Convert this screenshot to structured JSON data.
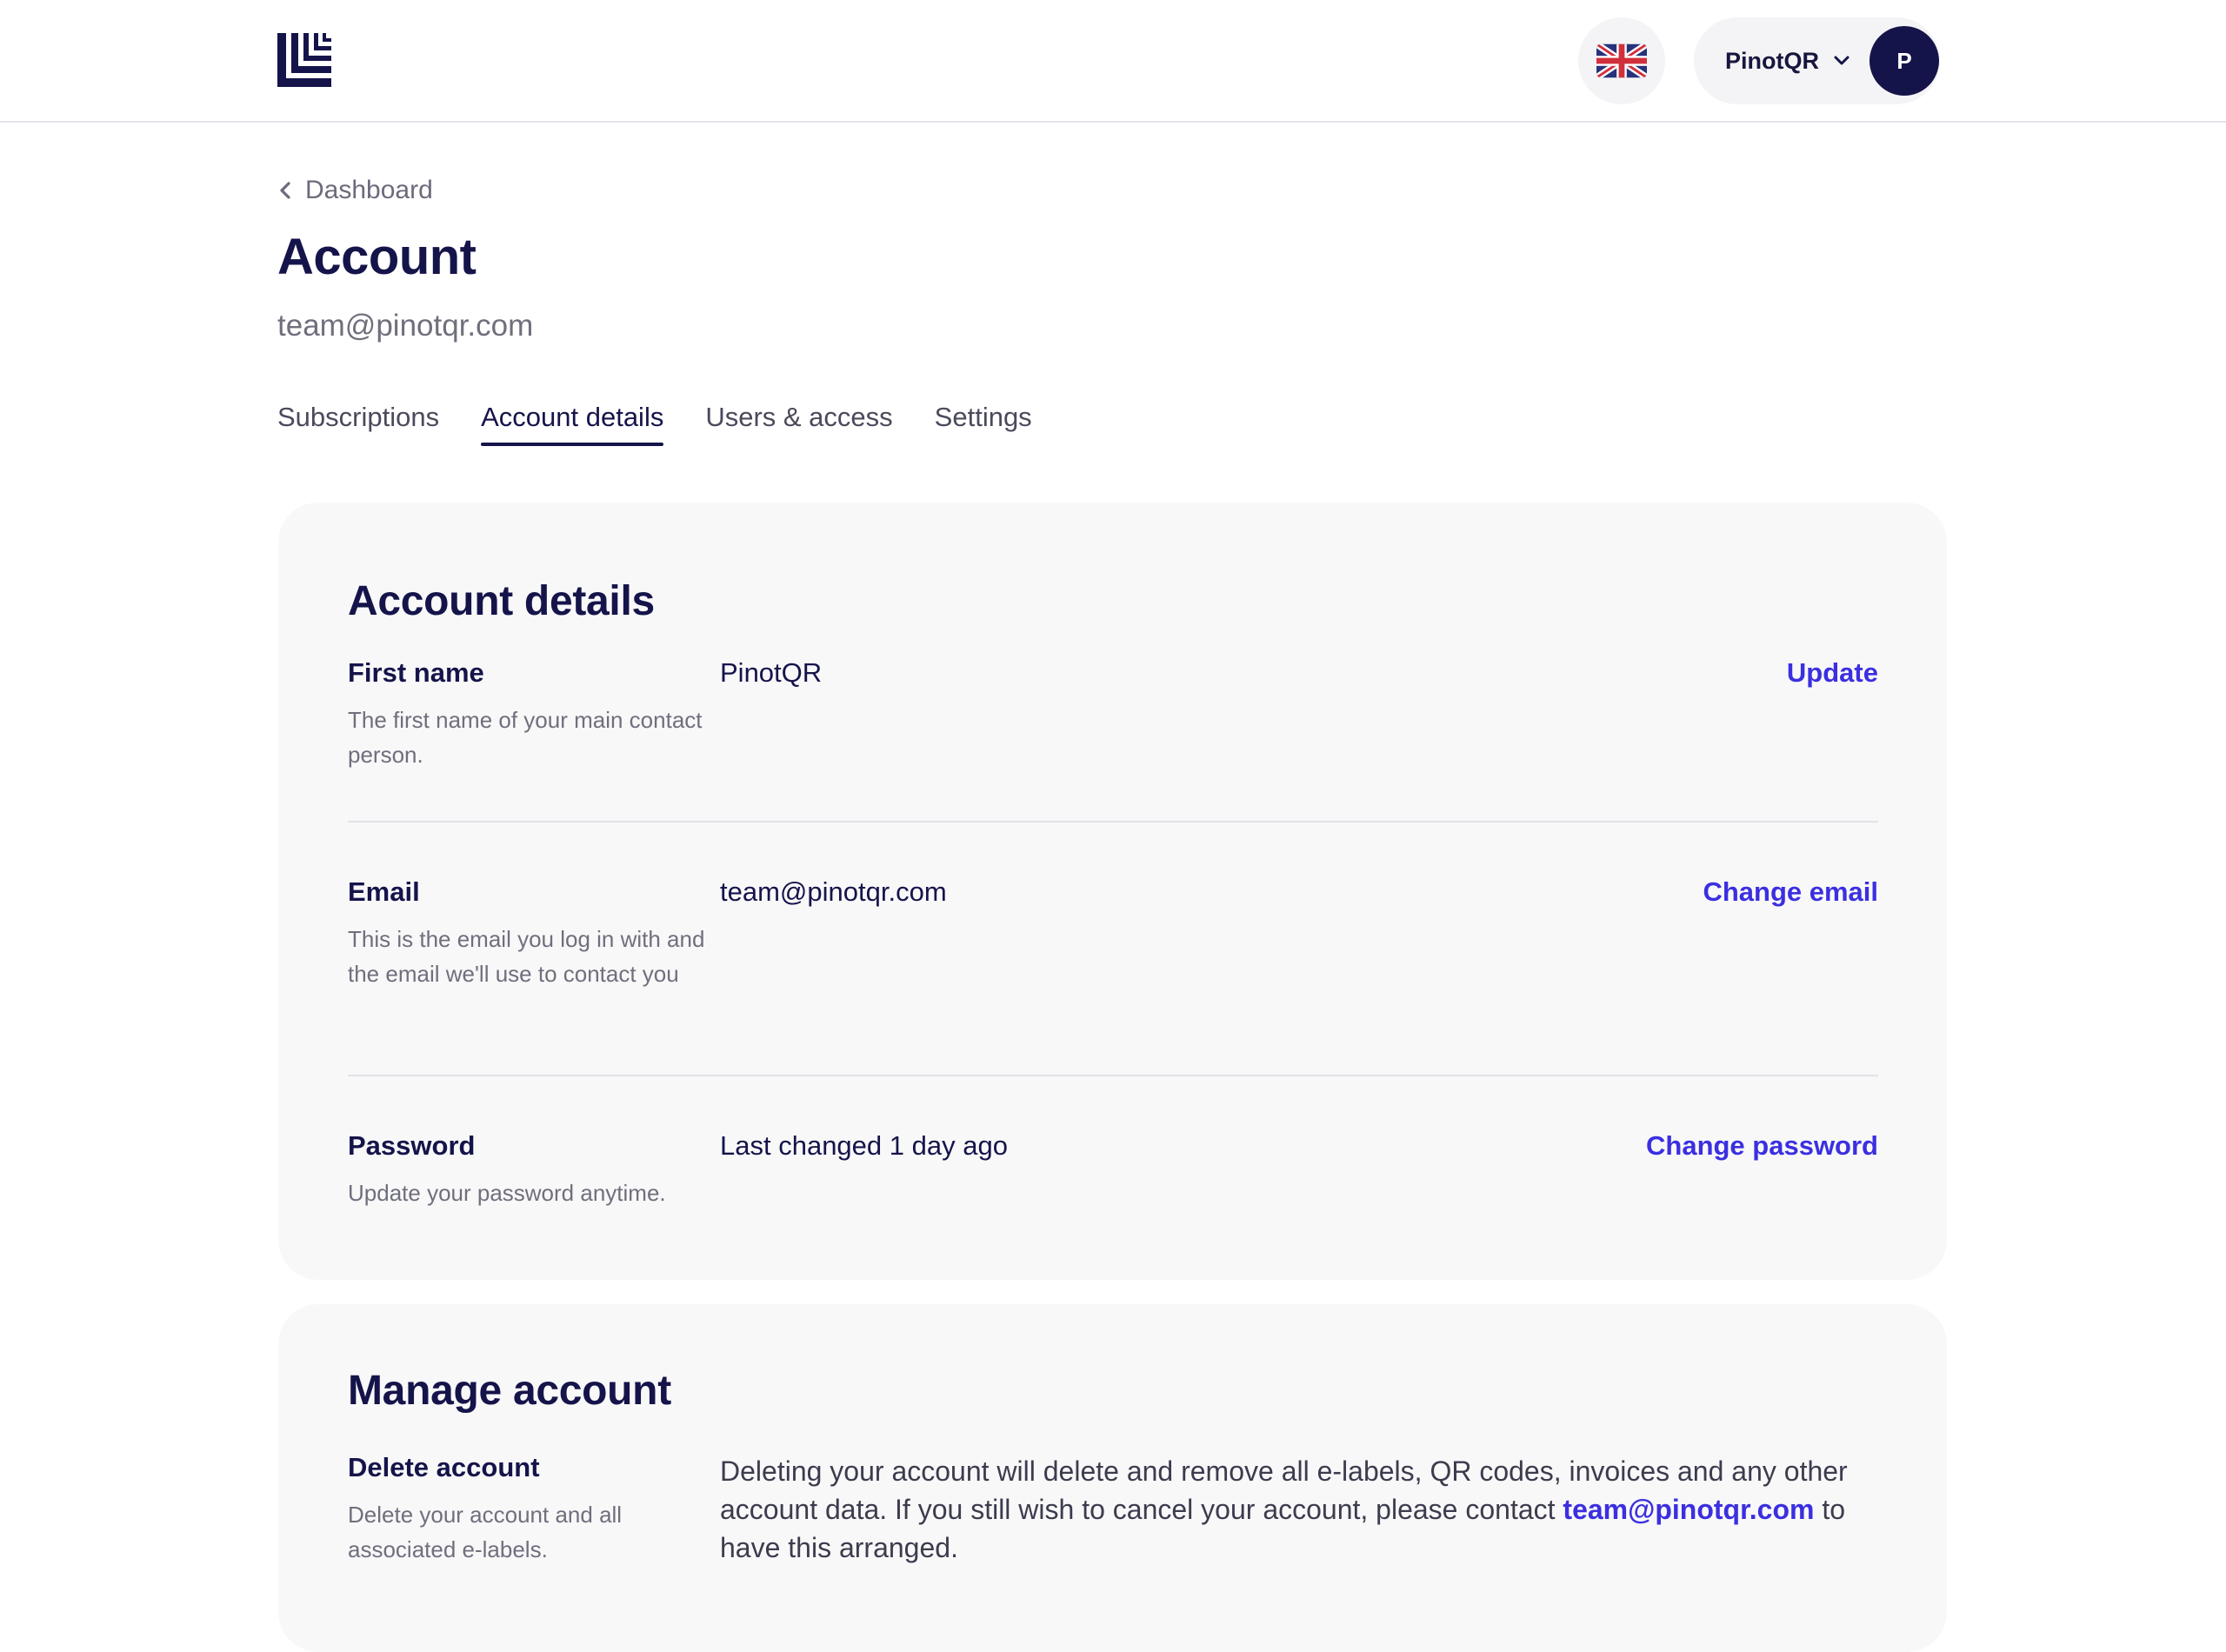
{
  "header": {
    "language": "English (UK)",
    "account_name": "PinotQR",
    "avatar_initial": "P"
  },
  "page": {
    "back_label": "Dashboard",
    "title": "Account",
    "subtitle": "team@pinotqr.com"
  },
  "tabs": [
    {
      "label": "Subscriptions",
      "active": false
    },
    {
      "label": "Account details",
      "active": true
    },
    {
      "label": "Users & access",
      "active": false
    },
    {
      "label": "Settings",
      "active": false
    }
  ],
  "account_details": {
    "title": "Account details",
    "rows": [
      {
        "label": "First name",
        "help": "The first name of your main contact person.",
        "value": "PinotQR",
        "action": "Update"
      },
      {
        "label": "Email",
        "help": "This is the email you log in with and the email we'll use to contact you",
        "value": "team@pinotqr.com",
        "action": "Change email"
      },
      {
        "label": "Password",
        "help": "Update your password anytime.",
        "value": "Last changed 1 day ago",
        "action": "Change password"
      }
    ]
  },
  "manage_account": {
    "title": "Manage account",
    "delete": {
      "label": "Delete account",
      "help": "Delete your account and all associated e-labels.",
      "desc_before": "Deleting your account will delete and remove all e-labels, QR codes, invoices and any other account data. If you still wish to cancel your account, please contact ",
      "desc_link": "team@pinotqr.com",
      "desc_after": " to have this arranged."
    }
  },
  "colors": {
    "brand_navy": "#15144a",
    "link_blue": "#3b2fe0"
  },
  "icons": {
    "logo": "brand-logo-icon",
    "language": "uk-flag-icon",
    "dropdown": "chevron-down-icon",
    "back": "chevron-left-icon"
  }
}
